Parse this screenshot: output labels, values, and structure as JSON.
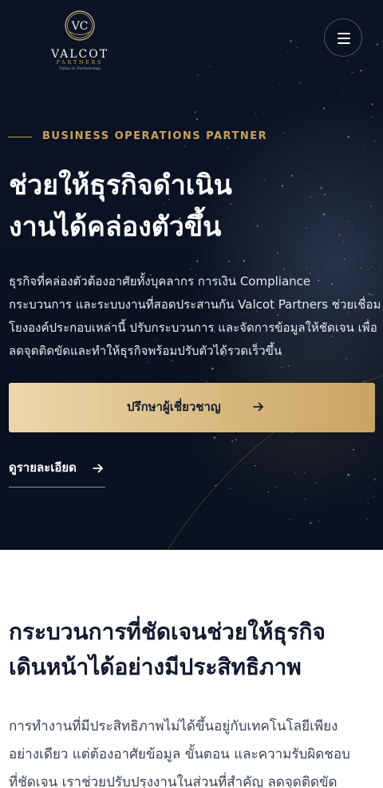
{
  "brand": {
    "monogram": "VC",
    "name": "VALCOT",
    "sub": "PARTNERS",
    "tagline": "Value in Partnership"
  },
  "hero": {
    "eyebrow": "BUSINESS OPERATIONS PARTNER",
    "title_lines": [
      "ช่วยให้ธุรกิจดำเนิน",
      "งานได้คล่องตัวขึ้น"
    ],
    "description_lines": [
      "ธุรกิจที่คล่องตัวต้องอาศัยทั้งบุคลากร การเงิน Compliance",
      "กระบวนการ และระบบงานที่สอดประสานกัน Valcot Partners ช่วยเชื่อม",
      "โยงองค์ประกอบเหล่านี้ ปรับกระบวนการ และจัดการข้อมูลให้ชัดเจน เพื่อ",
      "ลดจุดติดขัดและทำให้ธุรกิจพร้อมปรับตัวได้รวดเร็วขึ้น"
    ],
    "cta_label": "ปรึกษาผู้เชี่ยวชาญ",
    "details_label": "ดูรายละเอียด"
  },
  "section": {
    "title_lines": [
      "กระบวนการที่ชัดเจนช่วยให้ธุรกิจ",
      "เดินหน้าได้อย่างมีประสิทธิภาพ"
    ],
    "description_lines": [
      "การทำงานที่มีประสิทธิภาพไม่ได้ขึ้นอยู่กับเทคโนโลยีเพียง",
      "อย่างเดียว แต่ต้องอาศัยข้อมูล ขั้นตอน และความรับผิดชอบ",
      "ที่ชัดเจน เราช่วยปรับปรุงงานในส่วนที่สำคัญ ลดจุดติดขัด"
    ]
  },
  "icons": {
    "menu": "hamburger-menu-icon",
    "cta_arrow": "arrow-right-icon",
    "details_arrow": "arrow-right-icon"
  },
  "colors": {
    "hero_bg": "#0a1222",
    "gold": "#c9a25a",
    "cta_gradient_start": "#ebd8ac",
    "cta_gradient_end": "#c9a463",
    "heading_dark": "#111a2e"
  }
}
